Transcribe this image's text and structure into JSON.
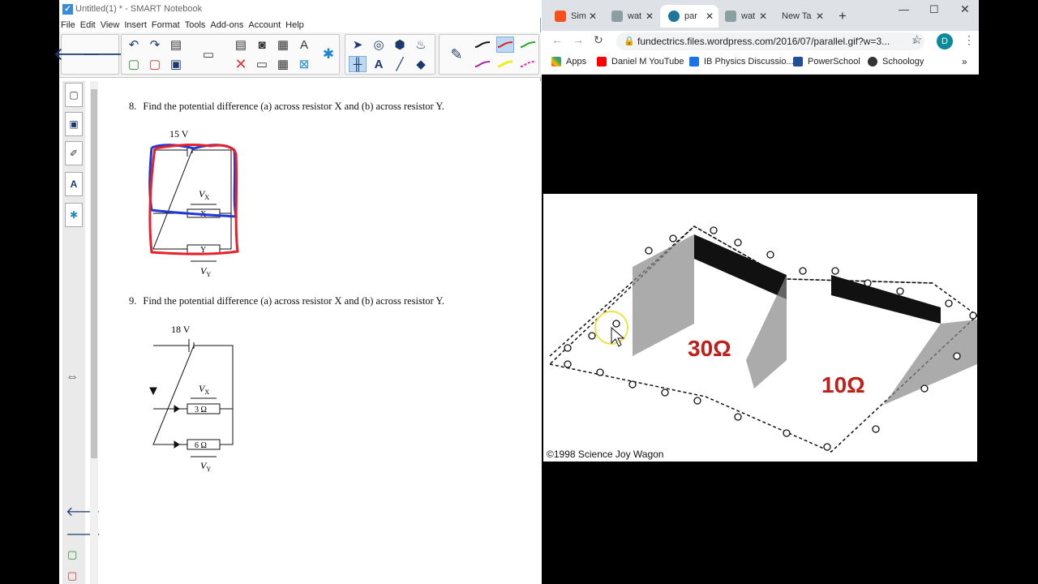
{
  "notebook": {
    "title": "Untitled(1) * - SMART Notebook",
    "menu": [
      "File",
      "Edit",
      "View",
      "Insert",
      "Format",
      "Tools",
      "Add-ons",
      "Account",
      "Help"
    ],
    "questions": [
      {
        "number": "8.",
        "text": "Find the potential difference (a) across resistor X and (b) across resistor Y.",
        "voltage": "15 V",
        "vx": "V",
        "vx_sub": "X",
        "vy": "V",
        "vy_sub": "Y",
        "r1": "X",
        "r2": "Y"
      },
      {
        "number": "9.",
        "text": "Find the potential difference (a) across resistor X and (b) across resistor Y.",
        "voltage": "18 V",
        "vx": "V",
        "vx_sub": "X",
        "vy": "V",
        "vy_sub": "Y",
        "r1": "3 Ω",
        "r2": "6 Ω"
      }
    ],
    "annotation_colors": {
      "red": "#e8202a",
      "blue": "#2038d8"
    }
  },
  "browser": {
    "tabs": [
      {
        "label": "Sim",
        "icon_color": "#f4511e"
      },
      {
        "label": "wat",
        "icon_color": "#8aa0a0"
      },
      {
        "label": "par",
        "icon_color": "#21759b",
        "active": true
      },
      {
        "label": "wat",
        "icon_color": "#8aa0a0"
      },
      {
        "label": "New Ta",
        "icon_color": ""
      }
    ],
    "url": "fundectrics.files.wordpress.com/2016/07/parallel.gif?w=3...",
    "profile_initial": "D",
    "bookmarks": [
      {
        "label": "Apps",
        "icon_color": "#ea4335"
      },
      {
        "label": "Daniel M YouTube",
        "icon_color": "#ff0000"
      },
      {
        "label": "IB Physics Discussio...",
        "icon_color": "#1a73e8"
      },
      {
        "label": "PowerSchool",
        "icon_color": "#1f4e9b"
      },
      {
        "label": "Schoology",
        "icon_color": "#333333"
      }
    ],
    "more_bookmarks": "»"
  },
  "gif": {
    "resistor1": "30Ω",
    "resistor2": "10Ω",
    "credit": "©1998 Science Joy Wagon",
    "label_color": "#c0201a"
  }
}
